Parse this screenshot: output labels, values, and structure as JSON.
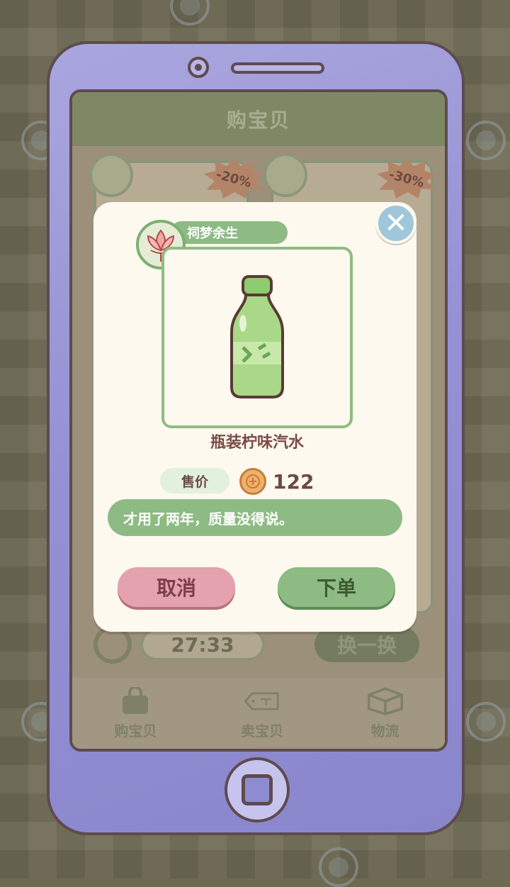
{
  "screen": {
    "title": "购宝贝",
    "timer": "27:33",
    "refresh_label": "换一换",
    "bg_tags": [
      "-20%",
      "-30%"
    ],
    "nav": [
      {
        "label": "购宝贝",
        "icon": "shopping-bag-icon"
      },
      {
        "label": "卖宝贝",
        "icon": "price-tag-icon"
      },
      {
        "label": "物流",
        "icon": "box-icon"
      }
    ]
  },
  "dialog": {
    "seller_name": "祠梦余生",
    "item_name": "瓶装柠味汽水",
    "price_label": "售价",
    "price": "122",
    "description": "才用了两年，质量没得说。",
    "cancel_label": "取消",
    "order_label": "下单",
    "close_icon": "close-icon"
  },
  "colors": {
    "accent_green": "#8dbb83",
    "cancel_pink": "#e4a1ae",
    "phone_purple": "#9591d4",
    "text_brown": "#6b4a45"
  }
}
